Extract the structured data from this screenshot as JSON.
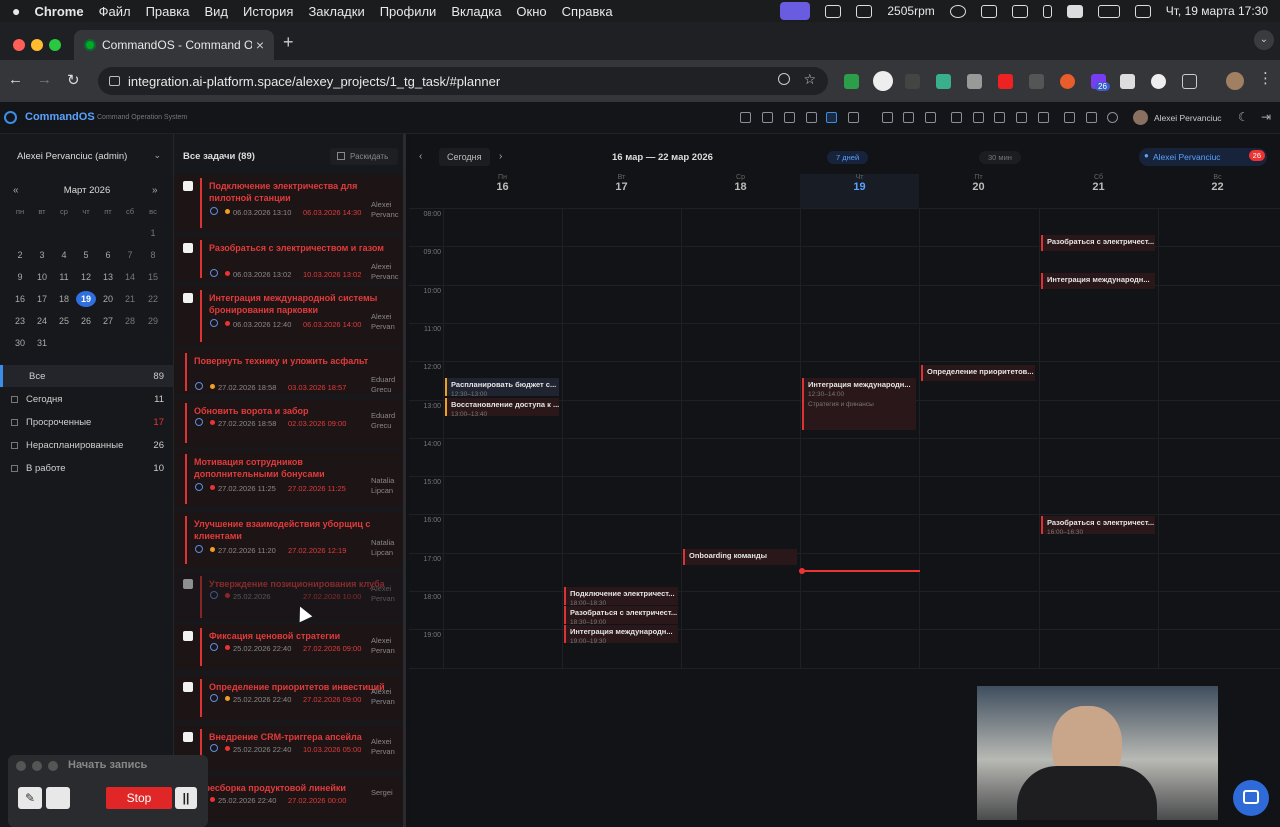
{
  "menubar": {
    "app": "Chrome",
    "items": [
      "Файл",
      "Правка",
      "Вид",
      "История",
      "Закладки",
      "Профили",
      "Вкладка",
      "Окно",
      "Справка"
    ],
    "rpm": "2505rpm",
    "datetime": "Чт, 19 марта  17:30"
  },
  "tab": {
    "title": "CommandOS - Command Op"
  },
  "address": {
    "url": "integration.ai-platform.space/alexey_projects/1_tg_task/#planner"
  },
  "ext_badge": "26",
  "app": {
    "brand": "CommandOS",
    "subtitle": "Command Operation System",
    "user": "Alexei Pervanciuc"
  },
  "sidebar": {
    "user": "Alexei Pervanciuc (admin)",
    "month": "Март 2026",
    "weekdays": [
      "пн",
      "вт",
      "ср",
      "чт",
      "пт",
      "сб",
      "вс"
    ],
    "weeks": [
      [
        "",
        "",
        "",
        "",
        "",
        "",
        "1"
      ],
      [
        "2",
        "3",
        "4",
        "5",
        "6",
        "7",
        "8"
      ],
      [
        "9",
        "10",
        "11",
        "12",
        "13",
        "14",
        "15"
      ],
      [
        "16",
        "17",
        "18",
        "19",
        "20",
        "21",
        "22"
      ],
      [
        "23",
        "24",
        "25",
        "26",
        "27",
        "28",
        "29"
      ],
      [
        "30",
        "31",
        "",
        "",
        "",
        "",
        ""
      ]
    ],
    "today": "19",
    "filters": [
      {
        "label": "Все",
        "count": "89"
      },
      {
        "label": "Сегодня",
        "count": "11"
      },
      {
        "label": "Просроченные",
        "count": "17"
      },
      {
        "label": "Нераспланированные",
        "count": "26"
      },
      {
        "label": "В работе",
        "count": "10"
      }
    ]
  },
  "tasks": {
    "header": "Все задачи (89)",
    "expand": "Раскидать",
    "items": [
      {
        "title": "Подключение электричества для пилотной станции",
        "created": "06.03.2026 13:10",
        "due": "06.03.2026 14:30",
        "assignee": "Alexei Pervanc"
      },
      {
        "title": "Разобраться с электричеством и газом",
        "created": "06.03.2026 13:02",
        "due": "10.03.2026 13:02",
        "assignee": "Alexei Pervanc"
      },
      {
        "title": "Интеграция международной системы бронирования парковки",
        "created": "06.03.2026 12:40",
        "due": "06.03.2026 14:00",
        "assignee": "Alexei Pervan"
      },
      {
        "title": "Повернуть технику и уложить асфальт",
        "created": "27.02.2026 18:58",
        "due": "03.03.2026 18:57",
        "assignee": "Eduard Grecu"
      },
      {
        "title": "Обновить ворота и забор",
        "created": "27.02.2026 18:58",
        "due": "02.03.2026 09:00",
        "assignee": "Eduard Grecu"
      },
      {
        "title": "Мотивация сотрудников дополнительными бонусами",
        "created": "27.02.2026 11:25",
        "due": "27.02.2026 11:25",
        "assignee": "Natalia Lipcan"
      },
      {
        "title": "Улучшение взаимодействия уборщиц с клиентами",
        "created": "27.02.2026 11:20",
        "due": "27.02.2026 12:19",
        "assignee": "Natalia Lipcan"
      },
      {
        "title": "Утверждение позиционирования клуба",
        "created": "25.02.2026",
        "due": "27.02.2026 10:00",
        "assignee": "Alexei Pervan"
      },
      {
        "title": "Фиксация ценовой стратегии",
        "created": "25.02.2026 22:40",
        "due": "27.02.2026 09:00",
        "assignee": "Alexei Pervan"
      },
      {
        "title": "Определение приоритетов инвестиций",
        "created": "25.02.2026 22:40",
        "due": "27.02.2026 09:00",
        "assignee": "Alexei Pervan"
      },
      {
        "title": "Внедрение CRM-триггера апсейла",
        "created": "25.02.2026 22:40",
        "due": "10.03.2026 05:00",
        "assignee": "Alexei Pervan"
      },
      {
        "title": "пересборка продуктовой линейки",
        "created": "25.02.2026 22:40",
        "due": "27.02.2026 00:00",
        "assignee": "Sergei"
      }
    ]
  },
  "planner": {
    "today_btn": "Сегодня",
    "range": "16 мар — 22 мар 2026",
    "view": "7 дней",
    "step": "30 мин",
    "user": "Alexei Pervanciuc",
    "badge": "26",
    "days": [
      {
        "n": "Пн",
        "d": "16"
      },
      {
        "n": "Вт",
        "d": "17"
      },
      {
        "n": "Ср",
        "d": "18"
      },
      {
        "n": "Чт",
        "d": "19"
      },
      {
        "n": "Пт",
        "d": "20"
      },
      {
        "n": "Сб",
        "d": "21"
      },
      {
        "n": "Вс",
        "d": "22"
      }
    ],
    "hours": [
      "08:00",
      "09:00",
      "10:00",
      "11:00",
      "12:00",
      "13:00",
      "14:00",
      "15:00",
      "16:00",
      "17:00",
      "18:00",
      "19:00"
    ],
    "events": [
      {
        "day": 5,
        "start": 8.7,
        "title": "Разобраться с электричест...",
        "time": ""
      },
      {
        "day": 5,
        "start": 9.7,
        "title": "Интеграция международн...",
        "time": ""
      },
      {
        "day": 4,
        "start": 12.1,
        "title": "Определение приоритетов...",
        "time": ""
      },
      {
        "day": 0,
        "start": 12.45,
        "title": "Распланировать бюджет с...",
        "time": "12:30–13:00"
      },
      {
        "day": 0,
        "start": 12.95,
        "title": "Восстановление доступа к ...",
        "time": "13:00–13:40"
      },
      {
        "day": 3,
        "start": 12.45,
        "title": "Интеграция международн...",
        "time": "12:30–14:00",
        "extra": "Стратегия и финансы"
      },
      {
        "day": 5,
        "start": 16.05,
        "title": "Разобраться с электричест...",
        "time": "16:00–16:30"
      },
      {
        "day": 2,
        "start": 16.9,
        "title": "Onboarding команды",
        "time": ""
      },
      {
        "day": 1,
        "start": 17.9,
        "title": "Подключение электричест...",
        "time": "18:00–18:30"
      },
      {
        "day": 1,
        "start": 18.4,
        "title": "Разобраться с электричест...",
        "time": "18:30–19:00"
      },
      {
        "day": 1,
        "start": 18.9,
        "title": "Интеграция международн...",
        "time": "19:00–19:30"
      }
    ]
  },
  "recorder": {
    "label": "Начать запись",
    "stop": "Stop"
  }
}
